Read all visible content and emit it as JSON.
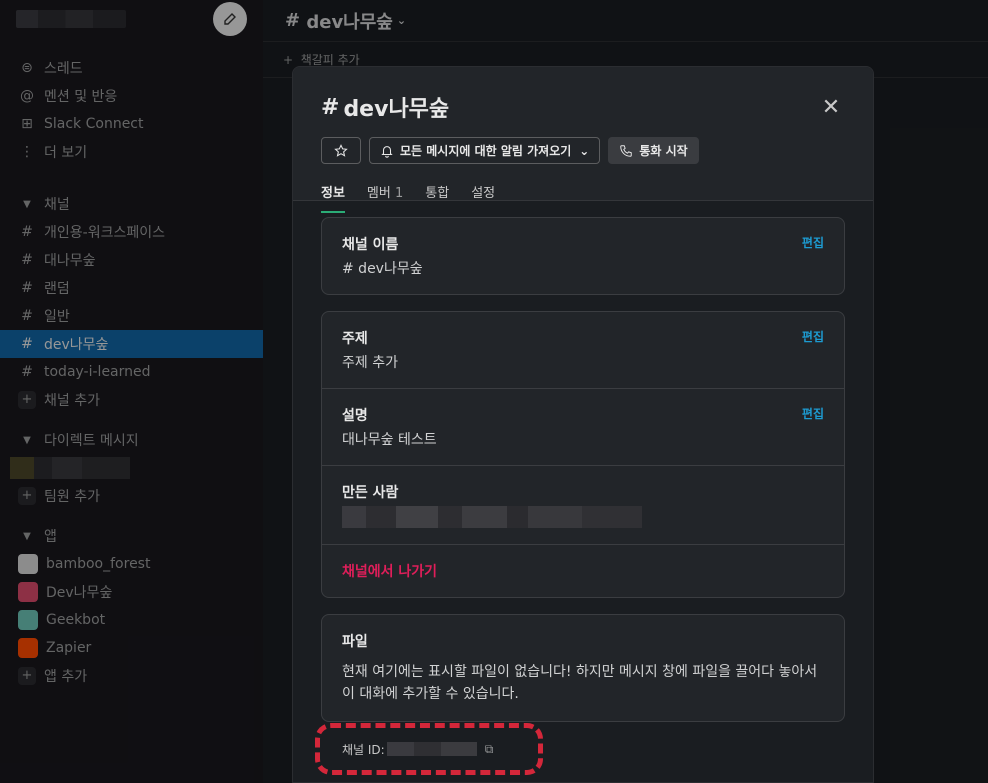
{
  "sidebar": {
    "nav": [
      {
        "icon": "threads-icon",
        "glyph": "⊜",
        "label": "스레드"
      },
      {
        "icon": "mention-icon",
        "glyph": "@",
        "label": "멘션 및 반응"
      },
      {
        "icon": "slack-connect-icon",
        "glyph": "⊞",
        "label": "Slack Connect"
      },
      {
        "icon": "more-icon",
        "glyph": "⋮",
        "label": "더 보기"
      }
    ],
    "channels_header": "채널",
    "channels": [
      {
        "label": "개인용-워크스페이스"
      },
      {
        "label": "대나무숲"
      },
      {
        "label": "랜덤"
      },
      {
        "label": "일반"
      },
      {
        "label": "dev나무숲"
      },
      {
        "label": "today-i-learned"
      }
    ],
    "add_channel": "채널 추가",
    "dm_header": "다이렉트 메시지",
    "add_member": "팀원 추가",
    "apps_header": "앱",
    "apps": [
      {
        "label": "bamboo_forest",
        "color": "#e8e8e8"
      },
      {
        "label": "Dev나무숲",
        "color": "#d94a6a"
      },
      {
        "label": "Geekbot",
        "color": "#6cc3b6"
      },
      {
        "label": "Zapier",
        "color": "#ff4a00"
      }
    ],
    "add_app": "앱 추가"
  },
  "main": {
    "channel_title": "dev나무숲",
    "bookmark_add": "책갈피 추가"
  },
  "modal": {
    "title": "dev나무숲",
    "notify_button": "모든 메시지에 대한 알림 가져오기",
    "call_button": "통화 시작",
    "tabs": {
      "info": "정보",
      "members": "멤버",
      "members_count": "1",
      "integrations": "통합",
      "settings": "설정"
    },
    "channel_name_label": "채널 이름",
    "channel_name_value": "# dev나무숲",
    "edit": "편집",
    "topic_label": "주제",
    "topic_value": "주제 추가",
    "description_label": "설명",
    "description_value": "대나무숲 테스트",
    "created_by_label": "만든 사람",
    "leave": "채널에서 나가기",
    "files_label": "파일",
    "files_text": "현재 여기에는 표시할 파일이 없습니다! 하지만 메시지 창에 파일을 끌어다 놓아서 이 대화에 추가할 수 있습니다.",
    "channel_id_label": "채널 ID:"
  },
  "colors": {
    "accent_green": "#2bac76",
    "link_blue": "#1d9bd1",
    "danger_red": "#e01e5a",
    "highlight_dash": "#d4273a",
    "active_channel": "#1164a3"
  }
}
